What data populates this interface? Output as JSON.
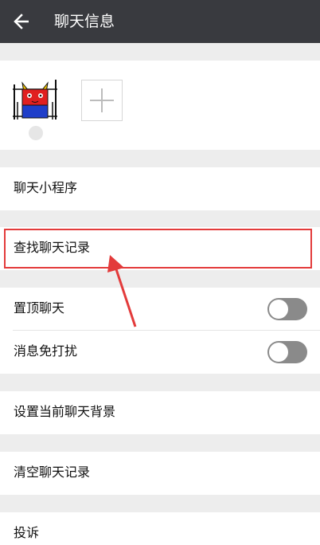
{
  "header": {
    "title": "聊天信息",
    "back_icon": "back-arrow-icon"
  },
  "members": {
    "add_icon": "plus-icon"
  },
  "rows": {
    "mini_program": "聊天小程序",
    "search_history": "查找聊天记录",
    "pin_chat": "置顶聊天",
    "mute": "消息免打扰",
    "set_background": "设置当前聊天背景",
    "clear_history": "清空聊天记录",
    "report": "投诉"
  },
  "toggles": {
    "pin_chat": false,
    "mute": false
  },
  "colors": {
    "header_bg": "#393a3f",
    "highlight": "#e33b3b",
    "toggle_off": "#8a8a8a"
  }
}
